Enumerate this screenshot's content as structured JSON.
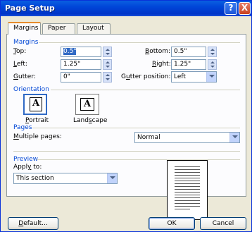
{
  "window": {
    "title": "Page Setup"
  },
  "titlebar": {
    "help": "?",
    "close": "X"
  },
  "tabs": [
    {
      "label": "Margins"
    },
    {
      "label": "Paper"
    },
    {
      "label": "Layout"
    }
  ],
  "margins": {
    "title": "Margins",
    "top": {
      "label_u": "T",
      "label_rest": "op:",
      "value": "0.5\""
    },
    "bottom": {
      "label_u": "B",
      "label_rest": "ottom:",
      "value": "0.5\""
    },
    "left": {
      "label_u": "L",
      "label_rest": "eft:",
      "value": "1.25\""
    },
    "right": {
      "label_u": "R",
      "label_rest": "ight:",
      "value": "1.25\""
    },
    "gutter": {
      "label_u": "G",
      "label_rest": "utter:",
      "value": "0\""
    },
    "gutter_position": {
      "label_pre": "G",
      "label_u": "u",
      "label_rest": "tter position:",
      "value": "Left"
    }
  },
  "orientation": {
    "title": "Orientation",
    "portrait": {
      "label_u": "P",
      "label_rest": "ortrait",
      "glyph": "A"
    },
    "landscape": {
      "label_pre": "Land",
      "label_u": "s",
      "label_rest": "cape",
      "glyph": "A"
    }
  },
  "pages": {
    "title": "Pages",
    "multiple_label_u": "M",
    "multiple_label_rest": "ultiple pages:",
    "multiple_value": "Normal"
  },
  "preview": {
    "title": "Preview",
    "apply_label_pre": "Appl",
    "apply_label_u": "y",
    "apply_label_rest": " to:",
    "apply_value": "This section"
  },
  "buttons": {
    "default_u": "D",
    "default_rest": "efault...",
    "ok": "OK",
    "cancel": "Cancel"
  }
}
